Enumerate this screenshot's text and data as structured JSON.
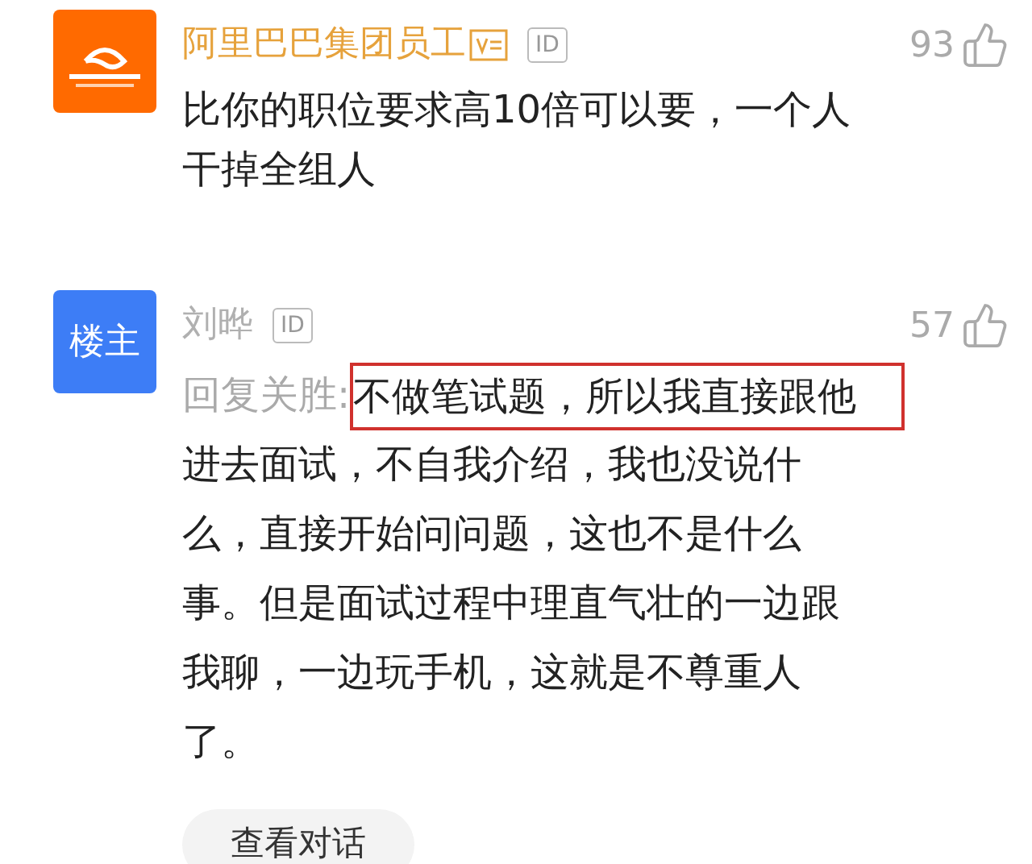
{
  "comments": [
    {
      "avatar": {
        "kind": "logo"
      },
      "name": "阿里巴巴集团员工",
      "color": "#e6a23c",
      "verified": true,
      "id_badge": "ID",
      "likes": "93",
      "lines": [
        "比你的职位要求高10倍可以要，一个人",
        "干掉全组人"
      ]
    },
    {
      "avatar": {
        "kind": "text",
        "label": "楼主"
      },
      "name": "刘晔",
      "color": "#b0b0b0",
      "verified": false,
      "id_badge": "ID",
      "likes": "57",
      "reply_prefix": "回复关胜:",
      "highlight": "不做笔试题，所以我直接跟他",
      "lines": [
        "进去面试，不自我介绍，我也没说什",
        "么，直接开始问问题，这也不是什么",
        "事。但是面试过程中理直气壮的一边跟",
        "我聊，一边玩手机，这就是不尊重人",
        "了。"
      ],
      "button": "查看对话"
    }
  ]
}
